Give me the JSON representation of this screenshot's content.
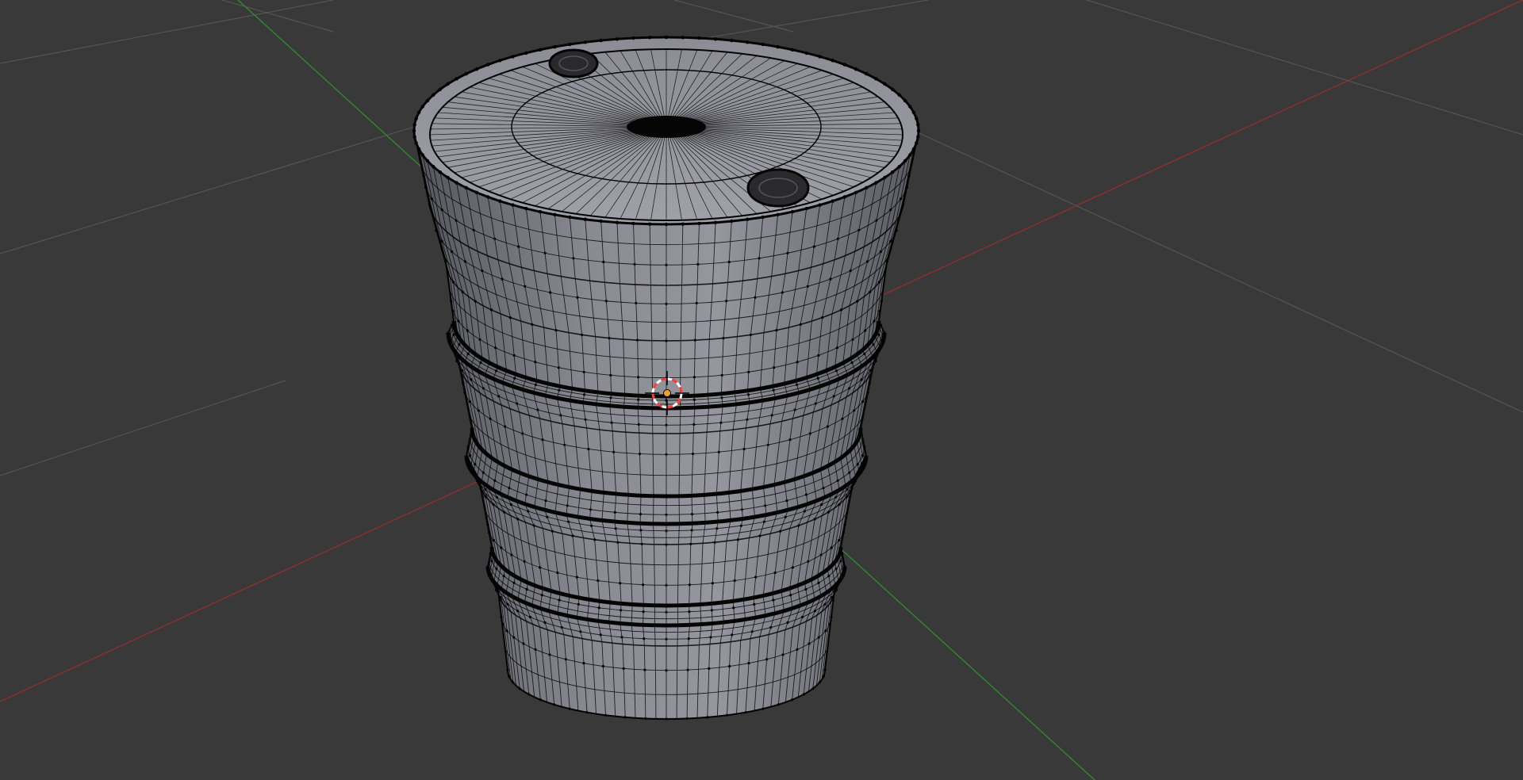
{
  "viewport": {
    "background": "#393939",
    "grid_color": "#555555",
    "x_axis_color": "#8f2e2e",
    "y_axis_color": "#2e8a2e",
    "mesh_face_color": "#8e8e96",
    "mesh_wire_color": "#050505",
    "mesh_vertex_color": "#000000",
    "cursor_color_a": "#ff3b3b",
    "cursor_color_b": "#ffffff",
    "origin_color": "#f0a030"
  },
  "scene": {
    "object": "barrel-mesh",
    "mode": "edit-mode",
    "display": "wireframe-with-vertices"
  }
}
